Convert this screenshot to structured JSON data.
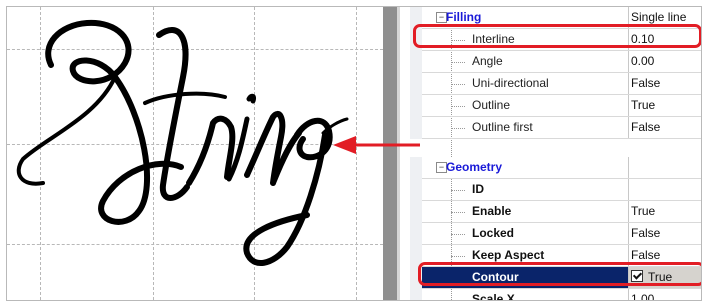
{
  "canvas": {
    "preview_word": "String"
  },
  "property_grid": {
    "rows": [
      {
        "type": "category",
        "expander": "−",
        "name": "Filling",
        "value": "Single line"
      },
      {
        "type": "property",
        "name": "Interline",
        "value": "0.10"
      },
      {
        "type": "property",
        "name": "Angle",
        "value": "0.00"
      },
      {
        "type": "property",
        "name": "Uni-directional",
        "value": "False"
      },
      {
        "type": "property",
        "name": "Outline",
        "value": "True"
      },
      {
        "type": "property",
        "name": "Outline first",
        "value": "False"
      },
      {
        "type": "category",
        "expander": "−",
        "name": "Geometry",
        "value": ""
      },
      {
        "type": "property",
        "name": "ID",
        "value": ""
      },
      {
        "type": "property",
        "name": "Enable",
        "value": "True"
      },
      {
        "type": "property",
        "name": "Locked",
        "value": "False"
      },
      {
        "type": "property",
        "name": "Keep Aspect",
        "value": "False"
      },
      {
        "type": "property",
        "name": "Contour",
        "value": "True",
        "checked": true
      },
      {
        "type": "property",
        "name": "Scale X",
        "value": "1.00"
      }
    ]
  },
  "colors": {
    "highlight": "#e21d25",
    "category_text": "#1a1ad8",
    "selected_row": "#0a246a"
  }
}
